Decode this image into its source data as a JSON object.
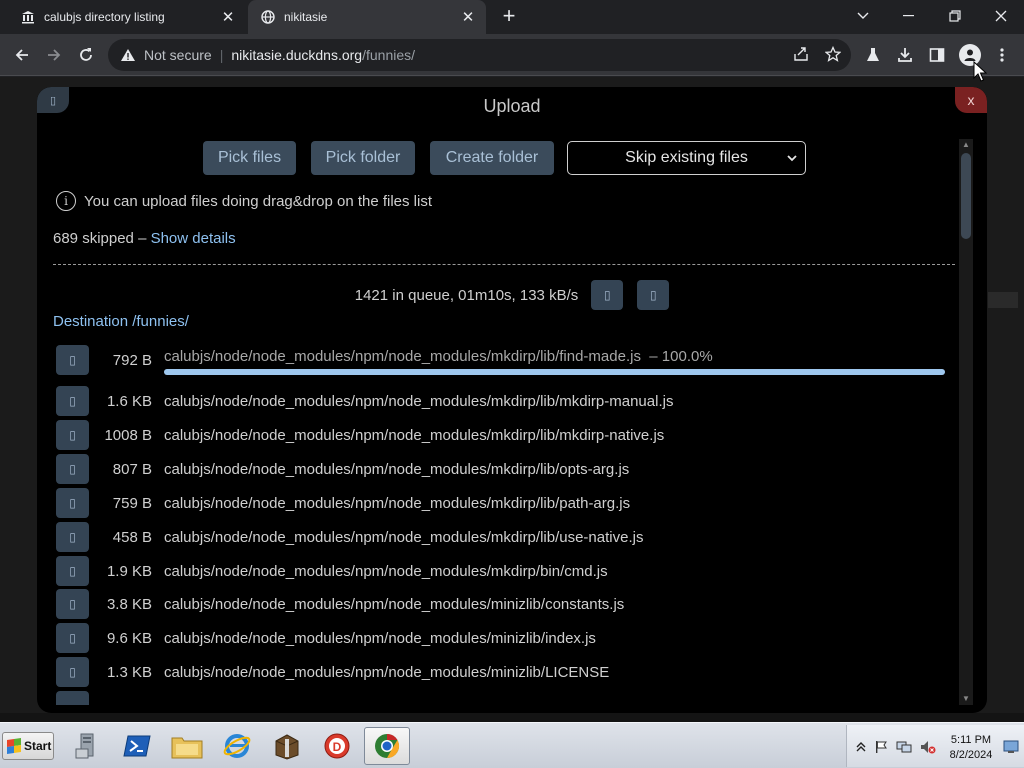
{
  "browser": {
    "tabs": [
      {
        "title": "calubjs directory listing",
        "active": false,
        "favicon": "library-icon"
      },
      {
        "title": "nikitasie",
        "active": true,
        "favicon": "globe-icon"
      }
    ],
    "new_tab_label": "+",
    "address": {
      "security_label": "Not secure",
      "host": "nikitasie.duckdns.org",
      "path": "/funnies/"
    }
  },
  "upload_modal": {
    "title": "Upload",
    "close_label": "x",
    "buttons": {
      "pick_files": "Pick files",
      "pick_folder": "Pick folder",
      "create_folder": "Create folder"
    },
    "mode_select": {
      "selected": "Skip existing files"
    },
    "info_text": "You can upload files doing drag&drop on the files list",
    "skipped_text": "689 skipped – ",
    "show_details": "Show details",
    "queue_status": "1421 in queue, 01m10s, 133 kB/s",
    "destination": "Destination /funnies/",
    "current_file": {
      "size": "792 B",
      "name": "calubjs/node/node_modules/npm/node_modules/mkdirp/lib/find-made.js",
      "progress_label": "– 100.0%",
      "progress": 1.0
    },
    "files": [
      {
        "size": "1.6 KB",
        "name": "calubjs/node/node_modules/npm/node_modules/mkdirp/lib/mkdirp-manual.js"
      },
      {
        "size": "1008 B",
        "name": "calubjs/node/node_modules/npm/node_modules/mkdirp/lib/mkdirp-native.js"
      },
      {
        "size": "807 B",
        "name": "calubjs/node/node_modules/npm/node_modules/mkdirp/lib/opts-arg.js"
      },
      {
        "size": "759 B",
        "name": "calubjs/node/node_modules/npm/node_modules/mkdirp/lib/path-arg.js"
      },
      {
        "size": "458 B",
        "name": "calubjs/node/node_modules/npm/node_modules/mkdirp/lib/use-native.js"
      },
      {
        "size": "1.9 KB",
        "name": "calubjs/node/node_modules/npm/node_modules/mkdirp/bin/cmd.js"
      },
      {
        "size": "3.8 KB",
        "name": "calubjs/node/node_modules/npm/node_modules/minizlib/constants.js"
      },
      {
        "size": "9.6 KB",
        "name": "calubjs/node/node_modules/npm/node_modules/minizlib/index.js"
      },
      {
        "size": "1.3 KB",
        "name": "calubjs/node/node_modules/npm/node_modules/minizlib/LICENSE"
      }
    ]
  },
  "taskbar": {
    "start_label": "Start",
    "clock_time": "5:11 PM",
    "clock_date": "8/2/2024"
  },
  "colors": {
    "accent_link": "#8ec1f0",
    "button_bg": "#3b4b5b",
    "close_bg": "#7a2121",
    "progress_fill": "#9ec7ee"
  }
}
